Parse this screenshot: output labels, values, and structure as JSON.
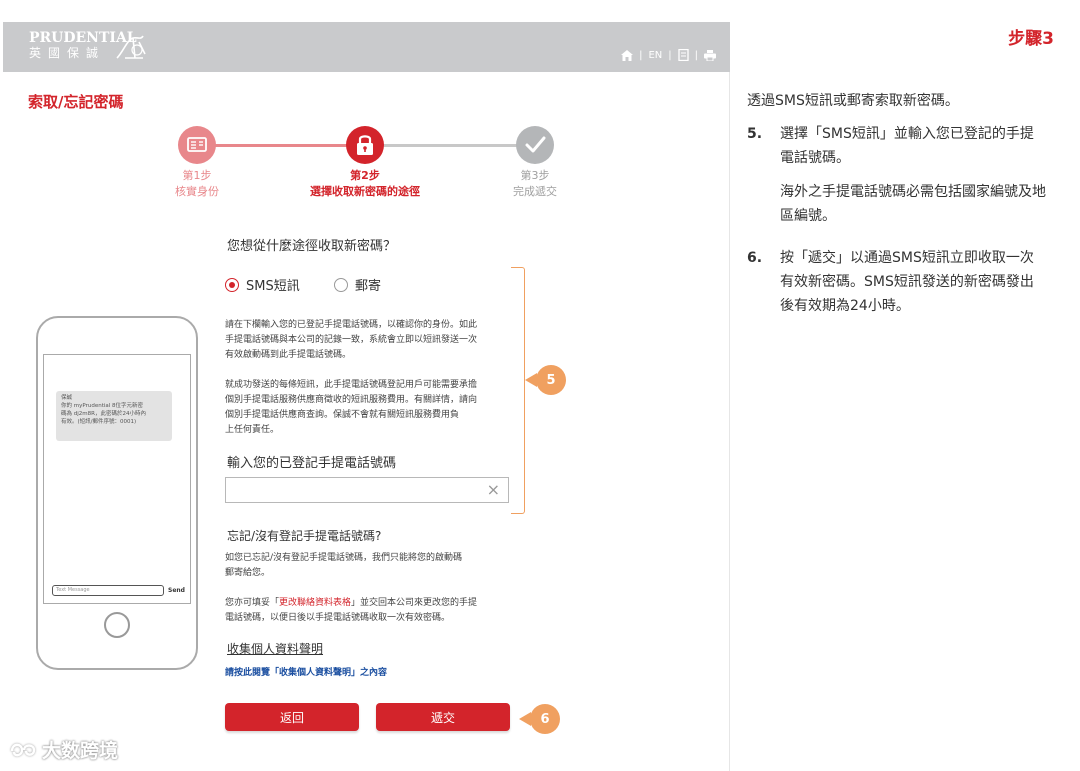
{
  "header": {
    "logo_en": "PRUDENTIAL",
    "logo_zh": "英國保誠",
    "lang": "EN"
  },
  "page_title": "索取/忘記密碼",
  "stepper": {
    "steps": [
      {
        "num": "第1步",
        "label": "核實身份",
        "state": "done"
      },
      {
        "num": "第2步",
        "label": "選擇收取新密碼的途徑",
        "state": "active"
      },
      {
        "num": "第3步",
        "label": "完成遞交",
        "state": "pending"
      }
    ]
  },
  "form": {
    "question": "您想從什麼途徑收取新密碼？",
    "options": [
      {
        "label": "SMS短訊",
        "selected": true
      },
      {
        "label": "郵寄",
        "selected": false
      }
    ],
    "para1": "請在下欄輸入您的已登記手提電話號碼，以確認你的身份。如此\n手提電話號碼與本公司的記錄一致，系統會立即以短訊發送一次\n有效啟動碼到此手提電話號碼。",
    "para2": "就成功發送的每條短訊，此手提電話號碼登記用戶可能需要承擔\n個別手提電話服務供應商徵收的短訊服務費用。有關詳情，請向\n個別手提電話供應商查詢。保誠不會就有關短訊服務費用負\n上任何責任。",
    "phone_label": "輸入您的已登記手提電話號碼",
    "phone_value": "",
    "forgot_title": "忘記/沒有登記手提電話號碼?",
    "forgot_text": "如您已忘記/沒有登記手提電話號碼，我們只能將您的啟動碼\n郵寄給您。",
    "change_pre": "您亦可填妥「",
    "change_link": "更改聯絡資料表格",
    "change_post": "」並交回本公司來更改您的手提\n電話號碼，以便日後以手提電話號碼收取一次有效密碼。",
    "privacy_title": "收集個人資料聲明",
    "privacy_link": "請按此閱覽「收集個人資料聲明」之內容",
    "back_label": "返回",
    "submit_label": "遞交"
  },
  "phone_mock": {
    "sms_text": "保誠\n你的 myPrudential 8位字元新密\n碼為 dj2m8R，此密碼於24小時內\n有效。(短訊/郵件序號：0001)",
    "input_placeholder": "Text Message",
    "send_label": "Send"
  },
  "badges": {
    "b5": "5",
    "b6": "6"
  },
  "guide": {
    "step_tag": "步驟3",
    "intro": "透過SMS短訊或郵寄索取新密碼。",
    "item5_num": "5.",
    "item5_text": "選擇「SMS短訊」並輸入您已登記的手提電話號碼。",
    "item5_note": "海外之手提電話號碼必需包括國家編號及地區編號。",
    "item6_num": "6.",
    "item6_text": "按「遞交」以通過SMS短訊立即收取一次有效新密碼。SMS短訊發送的新密碼發出後有效期為24小時。"
  },
  "watermark": "大数跨境",
  "colors": {
    "brand_red": "#d3242b",
    "pink": "#e8878b",
    "accent_orange": "#f0a060",
    "gray": "#b4b6b8",
    "header_gray": "#c9cacc"
  }
}
